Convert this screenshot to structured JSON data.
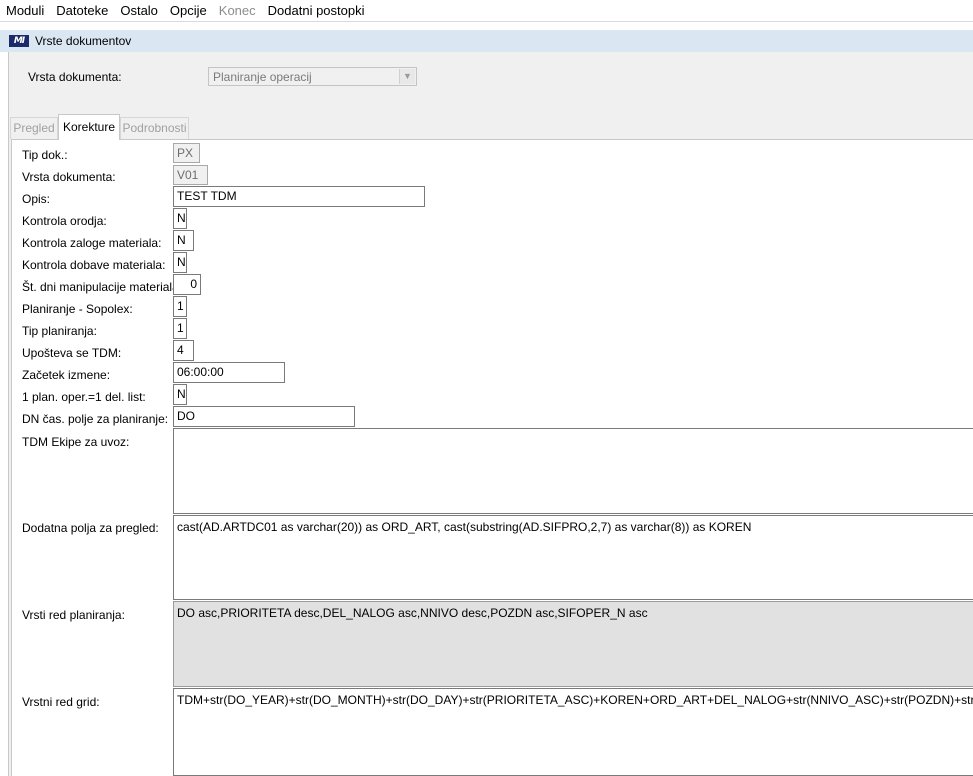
{
  "menu": [
    {
      "label": "Moduli",
      "disabled": false
    },
    {
      "label": "Datoteke",
      "disabled": false
    },
    {
      "label": "Ostalo",
      "disabled": false
    },
    {
      "label": "Opcije",
      "disabled": false
    },
    {
      "label": "Konec",
      "disabled": true
    },
    {
      "label": "Dodatni postopki",
      "disabled": false
    }
  ],
  "window": {
    "logo": "MI",
    "title": "Vrste dokumentov"
  },
  "doc_type": {
    "label": "Vrsta dokumenta:",
    "value": "Planiranje operacij"
  },
  "tabs": [
    "Pregled",
    "Korekture",
    "Podrobnosti"
  ],
  "active_tab": "Korekture",
  "form": {
    "tip_dok": {
      "label": "Tip dok.:",
      "value": "PX"
    },
    "vrsta_dok": {
      "label": "Vrsta dokumenta:",
      "value": "V01"
    },
    "opis": {
      "label": "Opis:",
      "value": "TEST TDM"
    },
    "kontrola_orodja": {
      "label": "Kontrola orodja:",
      "value": "N"
    },
    "kontrola_zaloge": {
      "label": "Kontrola zaloge materiala:",
      "value": "N"
    },
    "kontrola_dobave": {
      "label": "Kontrola dobave materiala:",
      "value": "N"
    },
    "st_dni": {
      "label": "Št. dni manipulacije materiala:",
      "value": "0"
    },
    "planiranje_sopolex": {
      "label": "Planiranje - Sopolex:",
      "value": "1"
    },
    "tip_planiranja": {
      "label": "Tip planiranja:",
      "value": "1"
    },
    "uposteva_tdm": {
      "label": "Upošteva se TDM:",
      "value": "4"
    },
    "zacetek_izmene": {
      "label": "Začetek izmene:",
      "value": "06:00:00"
    },
    "plan_oper": {
      "label": "1 plan. oper.=1 del. list:",
      "value": "N"
    },
    "dn_cas": {
      "label": "DN čas. polje za planiranje:",
      "value": "DO"
    },
    "tdm_ekipe": {
      "label": "TDM Ekipe za uvoz:",
      "value": ""
    },
    "dodatna_polja": {
      "label": "Dodatna polja za pregled:",
      "value": "cast(AD.ARTDC01 as varchar(20)) as ORD_ART, cast(substring(AD.SIFPRO,2,7) as varchar(8)) as KOREN"
    },
    "vrsti_red": {
      "label": "Vrsti red planiranja:",
      "value": "DO asc,PRIORITETA desc,DEL_NALOG asc,NNIVO desc,POZDN asc,SIFOPER_N asc"
    },
    "vrstni_red_grid": {
      "label": "Vrstni red grid:",
      "value": "TDM+str(DO_YEAR)+str(DO_MONTH)+str(DO_DAY)+str(PRIORITETA_ASC)+KOREN+ORD_ART+DEL_NALOG+str(NNIVO_ASC)+str(POZDN)+str(SIFOPER_N)"
    }
  }
}
